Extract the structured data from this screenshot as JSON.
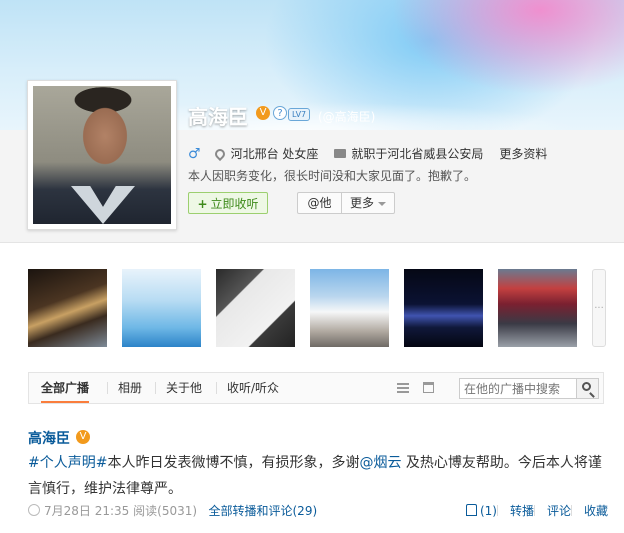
{
  "profile": {
    "name": "高海臣",
    "verified_badge": "V",
    "member_icon": "?",
    "level": "LV7",
    "handle": "(@高海臣)",
    "gender_icon": "male-icon",
    "location": "河北邢台 处女座",
    "job": "就职于河北省威县公安局",
    "more_info": "更多资料",
    "bio": "本人因职务变化，很长时间没和大家见面了。抱歉了。",
    "follow_label": "立即收听",
    "at_label": "@他",
    "more_label": "更多"
  },
  "photos": {
    "more_label": "···"
  },
  "tabs": {
    "items": [
      "全部广播",
      "相册",
      "关于他",
      "收听/听众"
    ],
    "search_placeholder": "在他的广播中搜索"
  },
  "post": {
    "author": "高海臣",
    "badge": "V",
    "tag": "#个人声明#",
    "text1": "本人昨日发表微博不慎，有损形象，多谢",
    "mention": "@烟云",
    "text2": " 及热心博友帮助。今后本人将谨言慎行，维护法律尊严。",
    "time": "7月28日 21:35",
    "reads": "阅读(5031)",
    "all_comments": "全部转播和评论(29)",
    "like": "(1)",
    "repost": "转播",
    "comment": "评论",
    "favorite": "收藏"
  },
  "colors": {
    "link": "#0a5b9a",
    "badge": "#f29a1c",
    "follow_green": "#3e8a1a",
    "tab_accent": "#fa7d3c"
  }
}
